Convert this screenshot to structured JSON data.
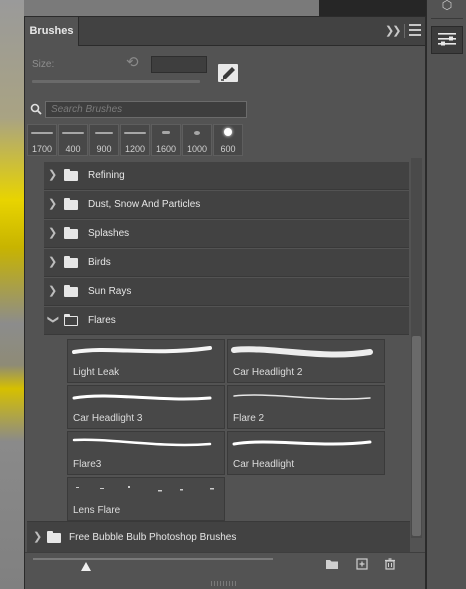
{
  "panel": {
    "tab_label": "Brushes",
    "size_label": "Size:",
    "search_placeholder": "Search Brushes"
  },
  "presets": [
    {
      "size": "1700"
    },
    {
      "size": "400"
    },
    {
      "size": "900"
    },
    {
      "size": "1200"
    },
    {
      "size": "1600"
    },
    {
      "size": "1000"
    },
    {
      "size": "600"
    }
  ],
  "groups": [
    {
      "label": "Refining",
      "expanded": false
    },
    {
      "label": "Dust, Snow And Particles",
      "expanded": false
    },
    {
      "label": "Splashes",
      "expanded": false
    },
    {
      "label": "Birds",
      "expanded": false
    },
    {
      "label": "Sun Rays",
      "expanded": false
    },
    {
      "label": "Flares",
      "expanded": true
    }
  ],
  "flares_brushes": [
    {
      "label": "Light Leak"
    },
    {
      "label": "Car Headlight 2"
    },
    {
      "label": "Car Headlight 3"
    },
    {
      "label": "Flare 2"
    },
    {
      "label": "Flare3"
    },
    {
      "label": "Car Headlight"
    },
    {
      "label": "Lens Flare"
    }
  ],
  "free_group": {
    "label": "Free Bubble Bulb Photoshop Brushes",
    "expanded": false
  },
  "icons": {
    "tab_collapse": "double-chevron-right-icon",
    "panel_menu": "hamburger-menu-icon",
    "reset": "reset-icon",
    "brush_settings": "brush-settings-icon",
    "search": "search-icon",
    "new_group": "new-folder-icon",
    "new_brush": "new-brush-icon",
    "delete": "trash-icon"
  }
}
